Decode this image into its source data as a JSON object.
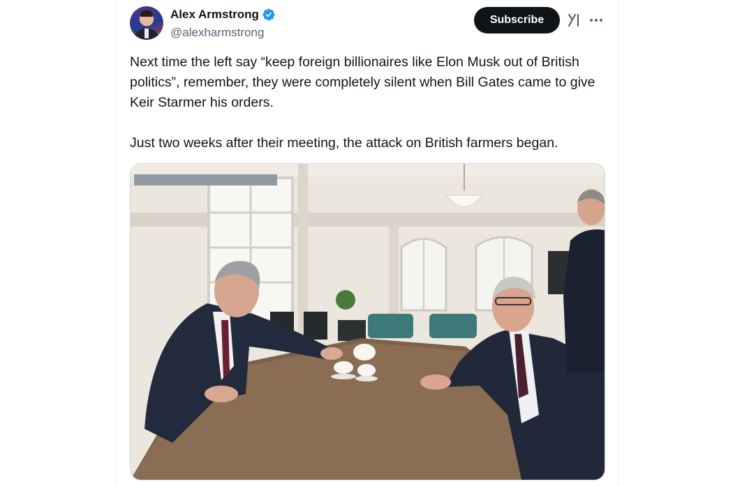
{
  "author": {
    "name": "Alex Armstrong",
    "handle": "@alexharmstrong",
    "verified": true
  },
  "actions": {
    "subscribe_label": "Subscribe",
    "grok_icon": "grok-icon",
    "more_icon": "more-icon"
  },
  "tweet": {
    "paragraphs": [
      "Next time the left say “keep foreign billionaires like Elon Musk out of British politics”, remember, they were completely silent when Bill Gates came to give Keir Starmer his orders.",
      "Just two weeks after their meeting, the attack on British farmers began."
    ]
  },
  "colors": {
    "text": "#0f1419",
    "secondary": "#536471",
    "verified": "#1d9bf0",
    "button": "#0f1419"
  }
}
